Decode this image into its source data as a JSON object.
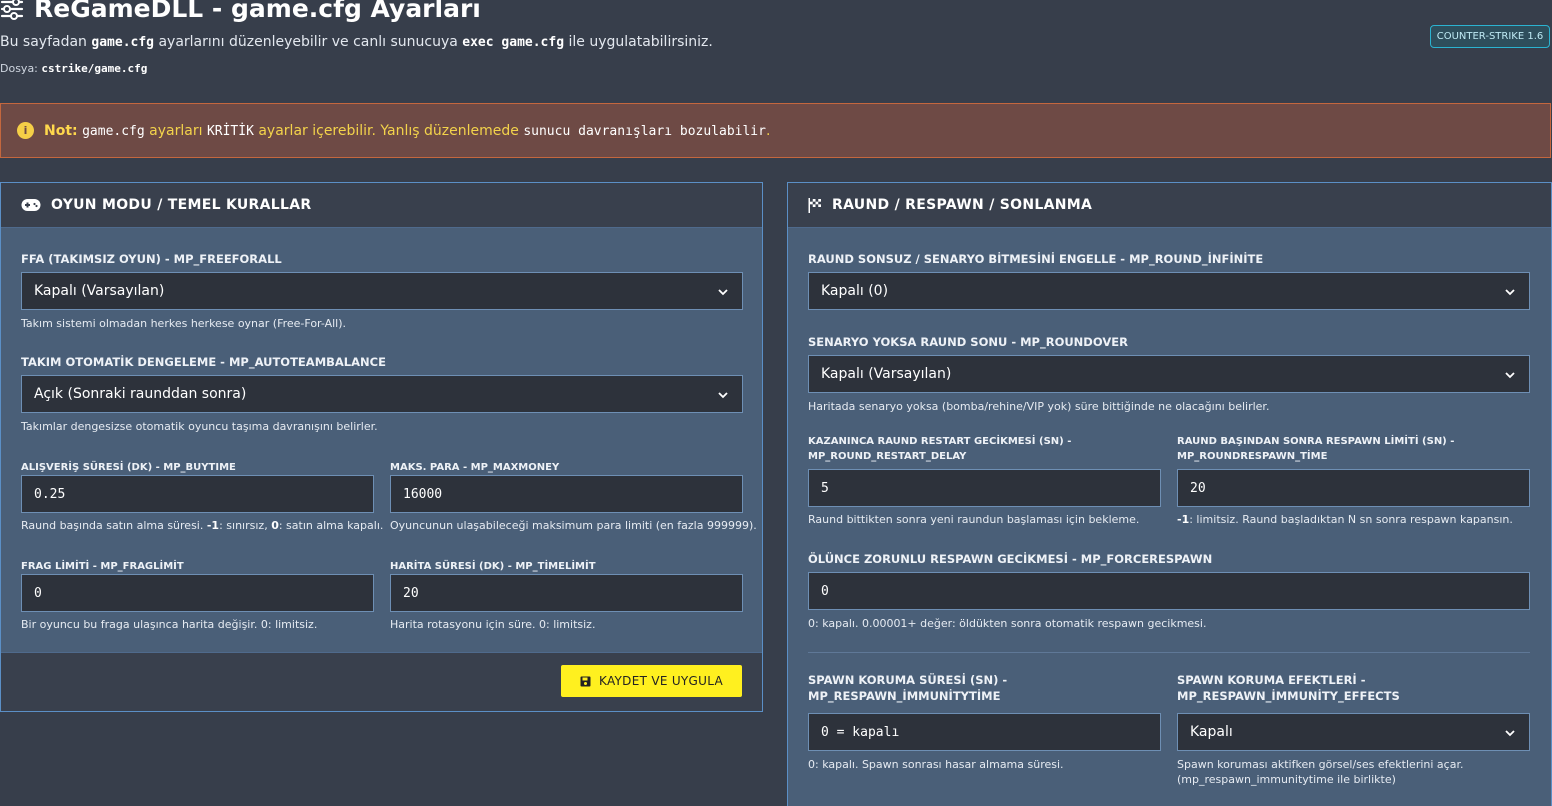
{
  "header": {
    "title": "ReGameDLL - game.cfg Ayarları",
    "subtitle_parts": [
      "Bu sayfadan ",
      "game.cfg",
      " ayarlarını düzenleyebilir ve canlı sunucuya ",
      "exec game.cfg",
      " ile uygulatabilirsiniz."
    ],
    "file_label": "Dosya:",
    "file_path": "cstrike/game.cfg",
    "badge": "COUNTER-STRIKE 1.6"
  },
  "warning": {
    "icon": "info-icon",
    "lead": "Not:",
    "code1": "game.cfg",
    "text1": " ayarları ",
    "code2": "KRİTİK",
    "text2": " ayarlar içerebilir. Yanlış düzenlemede ",
    "code3": "sunucu davranışları bozulabilir",
    "text3": "."
  },
  "left_panel": {
    "title": "OYUN MODU / TEMEL KURALLAR",
    "icon": "gamepad-icon",
    "freeforall": {
      "label": "FFA (TAKIMSIZ OYUN) - MP_FREEFORALL",
      "value": "Kapalı (Varsayılan)",
      "help": "Takım sistemi olmadan herkes herkese oynar (Free-For-All)."
    },
    "autoteambalance": {
      "label": "TAKIM OTOMATİK DENGELEME - MP_AUTOTEAMBALANCE",
      "value": "Açık (Sonraki raunddan sonra)",
      "help": "Takımlar dengesizse otomatik oyuncu taşıma davranışını belirler."
    },
    "buytime": {
      "label": "ALIŞVERİŞ SÜRESİ (DK) - MP_BUYTIME",
      "value": "0.25",
      "help_parts": [
        "Raund başında satın alma süresi. ",
        "-1",
        ": sınırsız, ",
        "0",
        ": satın alma kapalı."
      ]
    },
    "maxmoney": {
      "label": "MAKS. PARA - MP_MAXMONEY",
      "value": "16000",
      "help": "Oyuncunun ulaşabileceği maksimum para limiti (en fazla 999999)."
    },
    "fraglimit": {
      "label": "FRAG LİMİTİ - MP_FRAGLİMİT",
      "value": "0",
      "help": "Bir oyuncu bu fraga ulaşınca harita değişir. 0: limitsiz."
    },
    "timelimit": {
      "label": "HARİTA SÜRESİ (DK) - MP_TİMELİMİT",
      "value": "20",
      "help": "Harita rotasyonu için süre. 0: limitsiz."
    },
    "save_label": "KAYDET VE UYGULA"
  },
  "right_panel": {
    "title": "RAUND / RESPAWN / SONLANMA",
    "icon": "checkered-flag-icon",
    "round_infinite": {
      "label": "RAUND SONSUZ / SENARYO BİTMESİNİ ENGELLE - MP_ROUND_İNFİNİTE",
      "value": "Kapalı (0)"
    },
    "roundover": {
      "label": "SENARYO YOKSA RAUND SONU - MP_ROUNDOVER",
      "value": "Kapalı (Varsayılan)",
      "help": "Haritada senaryo yoksa (bomba/rehine/VIP yok) süre bittiğinde ne olacağını belirler."
    },
    "restart_delay": {
      "label_line1": "KAZANINCA RAUND RESTART GECİKMESİ (SN) -",
      "label_line2": "MP_ROUND_RESTART_DELAY",
      "value": "5",
      "help": "Raund bittikten sonra yeni raundun başlaması için bekleme."
    },
    "roundrespawn_time": {
      "label_line1": "RAUND BAŞINDAN SONRA RESPAWN LİMİTİ (SN) -",
      "label_line2": "MP_ROUNDRESPAWN_TİME",
      "value": "20",
      "help_bold": "-1",
      "help": ": limitsiz. Raund başladıktan N sn sonra respawn kapansın."
    },
    "forcerespawn": {
      "label": "ÖLÜNCE ZORUNLU RESPAWN GECİKMESİ - MP_FORCERESPAWN",
      "value": "0",
      "help": "0: kapalı. 0.00001+ değer: öldükten sonra otomatik respawn gecikmesi."
    },
    "immunitytime": {
      "label_line1": "SPAWN KORUMA SÜRESİ (SN) -",
      "label_line2": "MP_RESPAWN_İMMUNİTYTİME",
      "value": "0 = kapalı",
      "help": "0: kapalı. Spawn sonrası hasar almama süresi."
    },
    "immunity_effects": {
      "label_line1": "SPAWN KORUMA EFEKTLERİ -",
      "label_line2": "MP_RESPAWN_İMMUNİTY_EFFECTS",
      "value": "Kapalı",
      "help_line1": "Spawn koruması aktifken görsel/ses efektlerini açar.",
      "help_line2": "(mp_respawn_immunitytime ile birlikte)"
    }
  }
}
